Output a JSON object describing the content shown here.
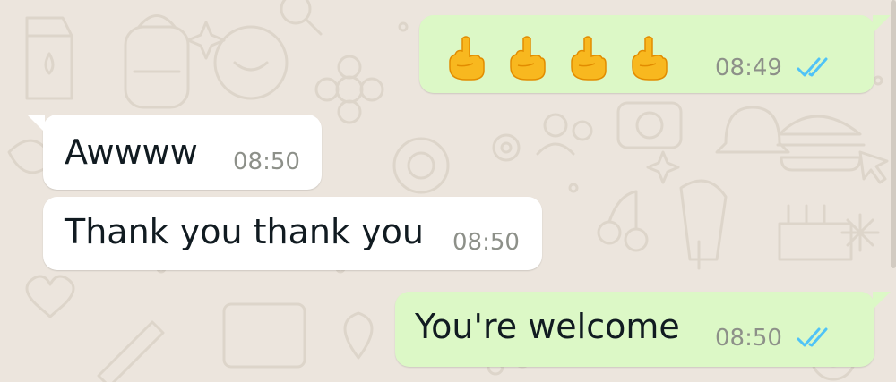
{
  "chat": {
    "theme": {
      "wallpaper_color": "#ece5dd",
      "incoming_bubble_color": "#ffffff",
      "outgoing_bubble_color": "#dcf8c6",
      "timestamp_color": "#8d9089",
      "read_receipt_color": "#4fc3f7"
    },
    "messages": [
      {
        "direction": "outgoing",
        "content_type": "emoji",
        "emoji": [
          "middle-finger-emoji",
          "middle-finger-emoji",
          "middle-finger-emoji",
          "middle-finger-emoji"
        ],
        "time": "08:49",
        "status": "read"
      },
      {
        "direction": "incoming",
        "text": "Awwww",
        "time": "08:50"
      },
      {
        "direction": "incoming",
        "text": "Thank you thank you",
        "time": "08:50"
      },
      {
        "direction": "outgoing",
        "text": "You're welcome",
        "time": "08:50",
        "status": "read"
      }
    ]
  }
}
